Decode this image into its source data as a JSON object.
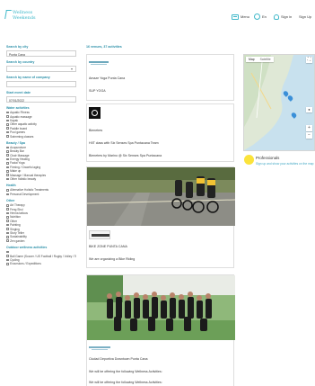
{
  "header": {
    "logo_line1": "Wellness",
    "logo_line2": "Weekends",
    "menu_label": "Menu",
    "lang_label": "En",
    "signin_label": "Sign in",
    "signup_label": "Sign Up"
  },
  "sidebar": {
    "city_label": "Search by city",
    "city_value": "Punta Cana",
    "country_label": "Search by country",
    "company_label": "Search by name of company",
    "date_label": "Start event date",
    "date_value": "07/01/2022",
    "categories": [
      {
        "title": "Water activities",
        "items": [
          "Aquatic Fitness",
          "Aquatic massage",
          "Kayak",
          "Other aquatic activity",
          "Paddle board",
          "Pool games",
          "Swimming classes"
        ]
      },
      {
        "title": "Beauty / Spa",
        "items": [
          "Acupuncture",
          "Beauty Bar",
          "Chair Massage",
          "Energy Healing",
          "Facial Yoga",
          "Firming / Graceful aging",
          "Make up",
          "Massage / Manual therapies",
          "Other holistic beauty"
        ]
      },
      {
        "title": "Health",
        "items": [
          "Alternative Holistic Treatments",
          "Personal Development"
        ]
      },
      {
        "title": "Other",
        "items": [
          "Art Therapy",
          "Feng Shui",
          "Henna tattoos",
          "Nutrition",
          "Other",
          "Painting",
          "Singing",
          "Story Teller",
          "Sustainability",
          "Zen garden"
        ]
      },
      {
        "title": "Outdoor wellness activities",
        "items": [
          "",
          "Ball Game (Soccer / US Football / Rugby / Volley / Tennis...)",
          "Cycling",
          "Excursions / Expeditions"
        ]
      }
    ]
  },
  "results": {
    "count_label": "16 venues, 37 activities",
    "cards": [
      {
        "title": "Amaze Yoga Punta Cana",
        "desc": "SUP YOGA"
      },
      {
        "title": "Bienetres",
        "desc1": "HIIT class with Six Senses Spa Puntacana Team",
        "desc2": "Bienetres by Marino @ Six Senses Spa Puntacana"
      },
      {
        "title": "BIKE ZONE PUNTA CANA",
        "desc": "We are organizing a Bike Riding"
      },
      {
        "title": "Ciudad Deportiva Downtown Punta Cana",
        "desc1": "We will be offering the following Wellness Activities:",
        "desc2": "We will be offering the following Wellness Activities:"
      }
    ]
  },
  "map": {
    "tab_map": "Map",
    "tab_satellite": "Satellite"
  },
  "professionals": {
    "title": "Professionals",
    "subtitle": "Sign up and show your activities on the map"
  },
  "colors": {
    "accent": "#3fb8c9",
    "label": "#2a8fa8",
    "pin": "#3a8fd8",
    "prof_icon": "#fbe33b"
  }
}
